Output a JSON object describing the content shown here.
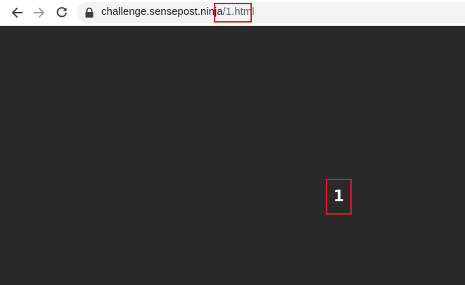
{
  "browser": {
    "url_host": "challenge.sensepost.ninja",
    "url_path": "/1.html",
    "icons": {
      "back": "arrow-left-icon",
      "forward": "arrow-right-icon",
      "reload": "reload-icon",
      "lock": "lock-icon"
    },
    "highlight_color": "#e01a1a"
  },
  "page": {
    "background": "#292929",
    "number_text": "1"
  }
}
